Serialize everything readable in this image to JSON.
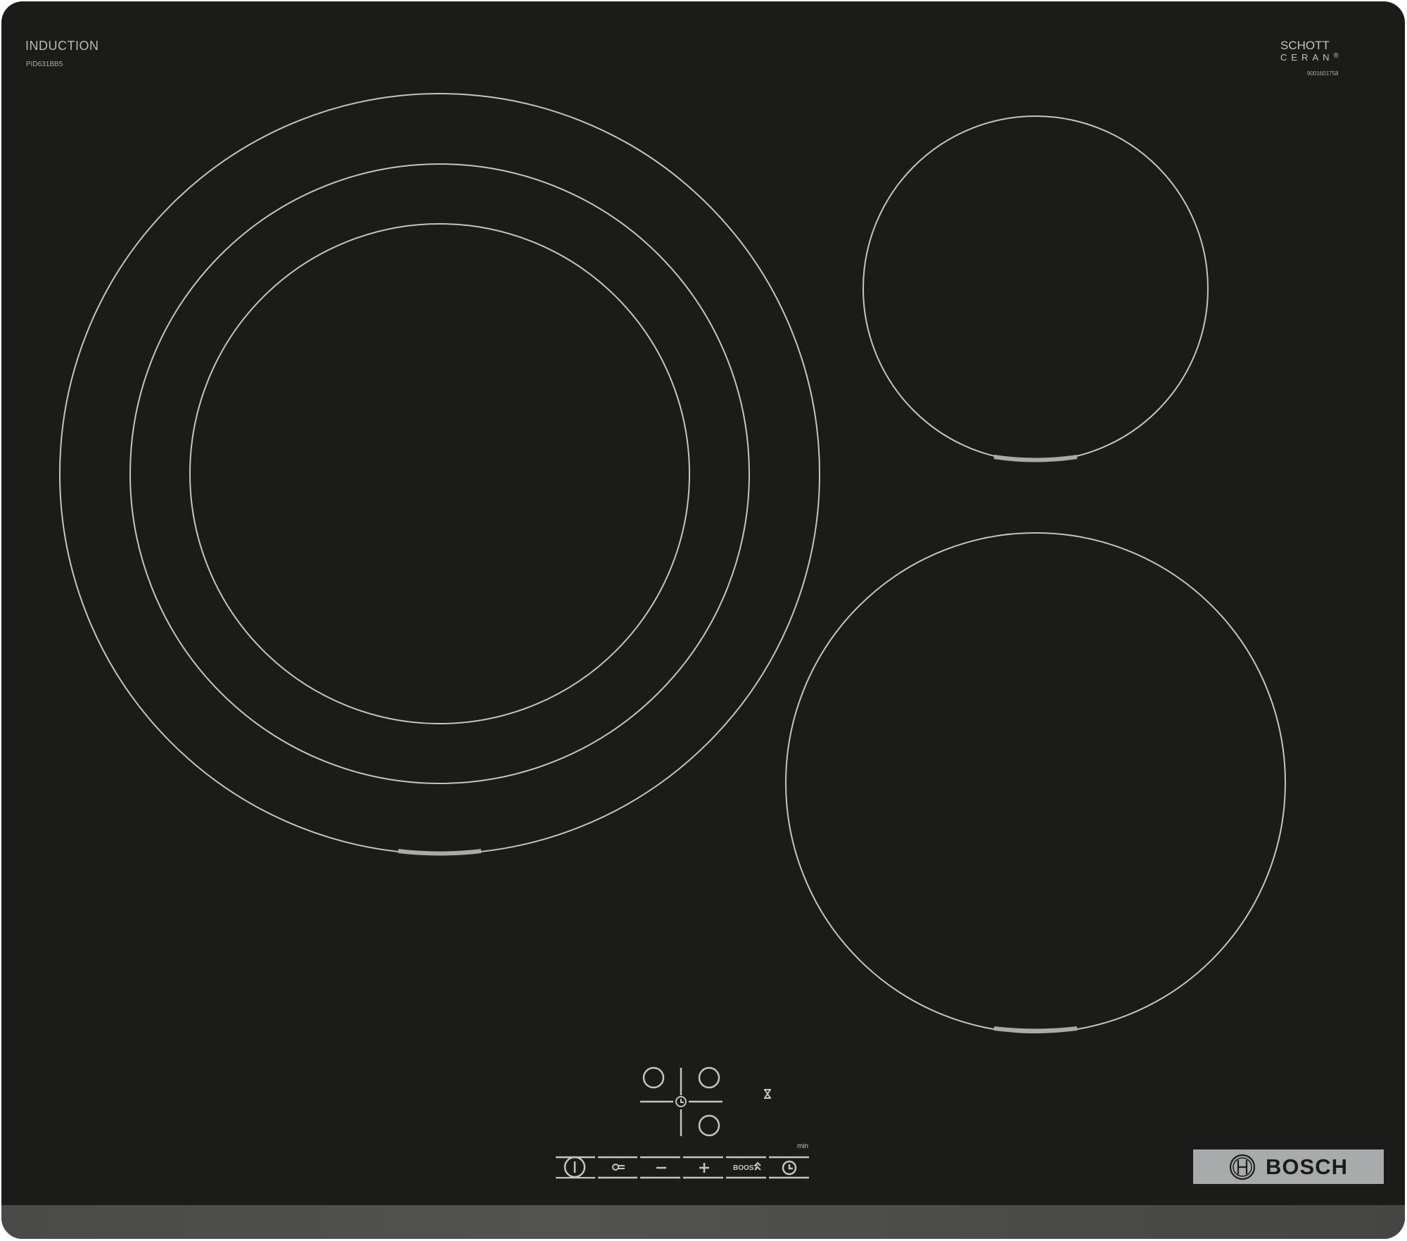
{
  "product": {
    "type_label": "INDUCTION",
    "model": "PID631BB5",
    "glass_brand_line1": "SCHOTT",
    "glass_brand_line2": "CERAN",
    "glass_brand_mark": "®",
    "serial": "9001601758",
    "brand": "BOSCH"
  },
  "colors": {
    "glass": "#1b1b19",
    "markings": "#c4c4c1",
    "frame": "#4c4c4a",
    "brand_plate": "#a9aaac"
  },
  "cooking_zones": [
    {
      "name": "large-zone-left",
      "rings": 3,
      "indicator": true
    },
    {
      "name": "small-zone-top-right",
      "rings": 1,
      "indicator": true
    },
    {
      "name": "medium-zone-bottom-right",
      "rings": 1,
      "indicator": true
    }
  ],
  "controls": {
    "zone_selector": [
      "zone-top-left",
      "zone-top-right",
      "zone-bottom-right"
    ],
    "timer_center_icon": "clock-icon",
    "hourglass_icon": "hourglass-icon",
    "min_label": "min",
    "bar": [
      {
        "name": "power-button",
        "icon": "power-icon"
      },
      {
        "name": "child-lock-button",
        "icon": "key-icon"
      },
      {
        "name": "minus-button",
        "icon": "minus-icon"
      },
      {
        "name": "plus-button",
        "icon": "plus-icon"
      },
      {
        "name": "boost-button",
        "label": "BOOST",
        "icon": "double-chevron-up-icon"
      },
      {
        "name": "timer-button",
        "icon": "clock-icon"
      }
    ]
  }
}
